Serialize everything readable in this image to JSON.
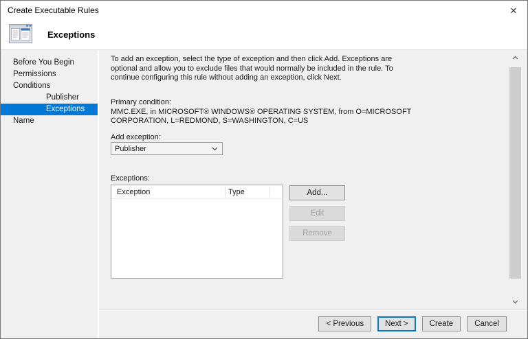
{
  "window": {
    "title": "Create Executable Rules"
  },
  "icons": {
    "close": "✕"
  },
  "header": {
    "title": "Exceptions"
  },
  "sidebar": {
    "items": [
      {
        "label": "Before You Begin",
        "indent": false,
        "selected": false
      },
      {
        "label": "Permissions",
        "indent": false,
        "selected": false
      },
      {
        "label": "Conditions",
        "indent": false,
        "selected": false
      },
      {
        "label": "Publisher",
        "indent": true,
        "selected": false
      },
      {
        "label": "Exceptions",
        "indent": true,
        "selected": true
      },
      {
        "label": "Name",
        "indent": false,
        "selected": false
      }
    ]
  },
  "main": {
    "intro_lines": [
      "To add an exception, select the type of exception and then click Add. Exceptions are",
      "optional and allow you to exclude files that would normally be included in the rule. To",
      "continue configuring this rule without adding an exception, click Next."
    ],
    "primary_condition_label": "Primary condition:",
    "primary_condition_lines": [
      "MMC.EXE, in MICROSOFT® WINDOWS® OPERATING SYSTEM, from O=MICROSOFT",
      "CORPORATION, L=REDMOND, S=WASHINGTON, C=US"
    ],
    "add_exception_label": "Add exception:",
    "add_exception_value": "Publisher",
    "exceptions_list_label": "Exceptions:",
    "list": {
      "columns": [
        "Exception",
        "Type"
      ],
      "rows": []
    },
    "buttons": {
      "add": "Add...",
      "edit": "Edit",
      "remove": "Remove"
    }
  },
  "footer": {
    "previous": "< Previous",
    "next": "Next >",
    "create": "Create",
    "cancel": "Cancel"
  },
  "colors": {
    "accent": "#0078d7",
    "content_bg": "#f0f0f0",
    "header_bg": "#ffffff",
    "selected_text": "#ffffff",
    "scroll_thumb": "#cdcdcd"
  }
}
